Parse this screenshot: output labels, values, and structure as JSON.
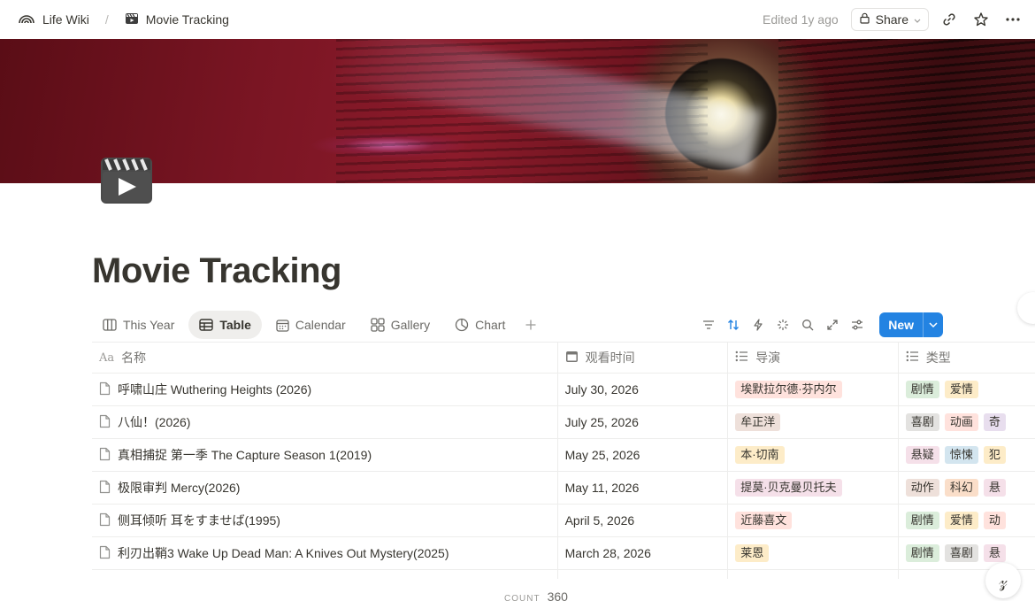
{
  "breadcrumb": {
    "workspace": "Life Wiki",
    "separator": "/",
    "page": "Movie Tracking"
  },
  "topbar": {
    "edited": "Edited 1y ago",
    "share_label": "Share"
  },
  "page": {
    "title": "Movie Tracking"
  },
  "views": {
    "tabs": [
      {
        "label": "This Year",
        "icon": "board-icon"
      },
      {
        "label": "Table",
        "icon": "table-icon"
      },
      {
        "label": "Calendar",
        "icon": "calendar-icon"
      },
      {
        "label": "Gallery",
        "icon": "gallery-icon"
      },
      {
        "label": "Chart",
        "icon": "chart-icon"
      }
    ],
    "active": "Table",
    "new_label": "New"
  },
  "table": {
    "columns": [
      {
        "label": "名称",
        "icon": "text-icon"
      },
      {
        "label": "观看时间",
        "icon": "calendar-icon"
      },
      {
        "label": "导演",
        "icon": "list-icon"
      },
      {
        "label": "类型",
        "icon": "list-icon"
      }
    ],
    "rows": [
      {
        "name": "呼啸山庄 Wuthering Heights (2026)",
        "date": "July 30, 2026",
        "director": "埃默拉尔德·芬内尔",
        "genres": [
          "剧情",
          "爱情"
        ]
      },
      {
        "name": "八仙！(2026)",
        "date": "July 25, 2026",
        "director": "牟正洋",
        "genres": [
          "喜剧",
          "动画",
          "奇"
        ]
      },
      {
        "name": "真相捕捉 第一季 The Capture Season 1(2019)",
        "date": "May 25, 2026",
        "director": "本·切南",
        "genres": [
          "悬疑",
          "惊悚",
          "犯"
        ]
      },
      {
        "name": "极限审判 Mercy(2026)",
        "date": "May 11, 2026",
        "director": "提莫·贝克曼贝托夫",
        "genres": [
          "动作",
          "科幻",
          "悬"
        ]
      },
      {
        "name": "侧耳倾听 耳をすませば(1995)",
        "date": "April 5, 2026",
        "director": "近藤喜文",
        "genres": [
          "剧情",
          "爱情",
          "动"
        ]
      },
      {
        "name": "利刃出鞘3 Wake Up Dead Man: A Knives Out Mystery(2025)",
        "date": "March 28, 2026",
        "director": "莱恩",
        "genres": [
          "剧情",
          "喜剧",
          "悬"
        ]
      }
    ],
    "count_label": "COUNT",
    "count_value": "360"
  },
  "colors": {
    "accent": "#2383e2",
    "tag_red": "#ffe2dd",
    "tag_brown": "#eee0da",
    "tag_yellow": "#fdecc8",
    "tag_green": "#dbeddb",
    "tag_pink": "#f5e0e9",
    "tag_blue": "#d3e5ef",
    "tag_gray": "#e3e2e0",
    "tag_purple": "#e8deee",
    "tag_orange": "#fadec9"
  }
}
